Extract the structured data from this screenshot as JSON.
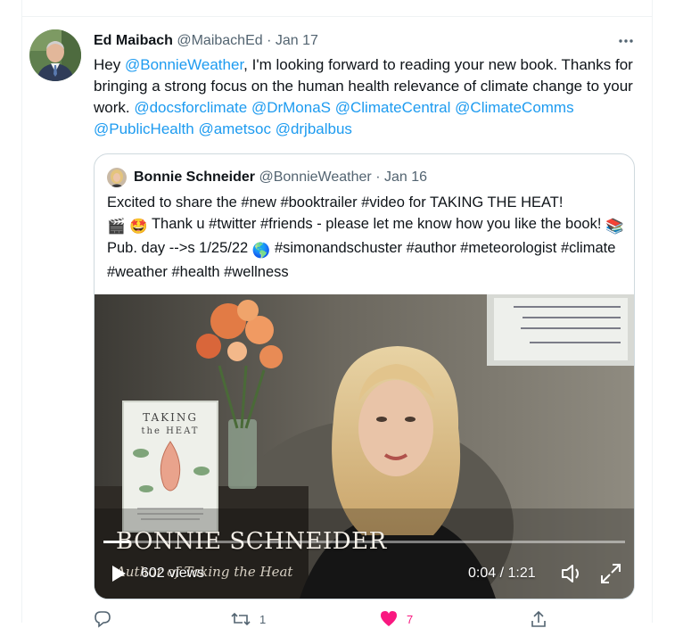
{
  "tweet": {
    "author": {
      "display_name": "Ed Maibach",
      "handle": "@MaibachEd"
    },
    "separator": "·",
    "date": "Jan 17",
    "more_icon": "more-horizontal-icon",
    "text_parts": [
      {
        "t": "Hey ",
        "mention": false
      },
      {
        "t": "@BonnieWeather",
        "mention": true
      },
      {
        "t": ", I'm looking forward to reading your new book. Thanks for bringing a strong focus on the human health relevance of climate change to your work. ",
        "mention": false
      },
      {
        "t": "@docsforclimate",
        "mention": true
      },
      {
        "t": " ",
        "mention": false
      },
      {
        "t": "@DrMonaS",
        "mention": true
      },
      {
        "t": " ",
        "mention": false
      },
      {
        "t": "@ClimateCentral",
        "mention": true
      },
      {
        "t": " ",
        "mention": false
      },
      {
        "t": "@ClimateComms",
        "mention": true
      },
      {
        "t": " ",
        "mention": false
      },
      {
        "t": "@PublicHealth",
        "mention": true
      },
      {
        "t": " ",
        "mention": false
      },
      {
        "t": "@ametsoc",
        "mention": true
      },
      {
        "t": " ",
        "mention": false
      },
      {
        "t": "@drjbalbus",
        "mention": true
      }
    ]
  },
  "quote": {
    "author": {
      "display_name": "Bonnie Schneider",
      "handle": "@BonnieWeather"
    },
    "separator": "·",
    "date": "Jan 16",
    "text_parts": [
      {
        "t": "Excited to share the #new #booktrailer #video for TAKING THE HEAT!",
        "emoji": false
      },
      {
        "t": "\n",
        "emoji": false
      },
      {
        "t": "🎬",
        "emoji": true
      },
      {
        "t": " ",
        "emoji": false
      },
      {
        "t": "🤩",
        "emoji": true
      },
      {
        "t": " Thank u #twitter #friends - please let me know how you like the book! ",
        "emoji": false
      },
      {
        "t": "📚",
        "emoji": true
      },
      {
        "t": "Pub. day -->s 1/25/22 ",
        "emoji": false
      },
      {
        "t": "🌎",
        "emoji": true
      },
      {
        "t": " #simonandschuster #author #meteorologist #climate #weather #health #wellness",
        "emoji": false
      }
    ],
    "video": {
      "overlay_title": "BONNIE SCHNEIDER",
      "overlay_subtitle": "Author of Taking the Heat",
      "book_title": "TAKING\nthe HEAT",
      "views": "602 views",
      "time": "0:04 / 1:21",
      "progress": 0.05,
      "icons": {
        "play": "play-icon",
        "volume": "volume-icon",
        "fullscreen": "fullscreen-icon"
      }
    }
  },
  "actions": [
    {
      "icon": "reply-icon",
      "count": ""
    },
    {
      "icon": "retweet-icon",
      "count": "1"
    },
    {
      "icon": "like-icon",
      "count": "7"
    },
    {
      "icon": "share-icon",
      "count": ""
    }
  ],
  "colors": {
    "accent": "#1d9bf0",
    "text": "#0f1419",
    "muted": "#536471",
    "border": "#cfd9de",
    "like": "#f91880"
  }
}
